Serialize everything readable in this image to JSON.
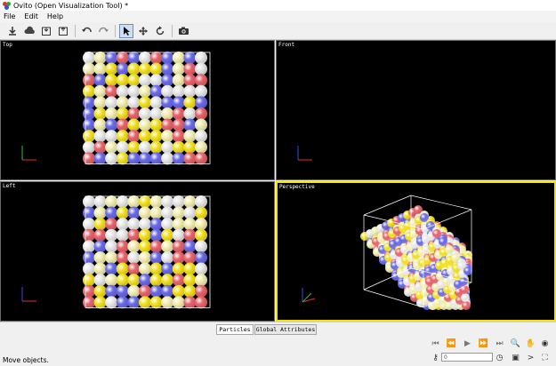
{
  "window": {
    "title": "Ovito (Open Visualization Tool) *"
  },
  "menu": [
    "File",
    "Edit",
    "Help"
  ],
  "toolbar": {
    "icons": [
      "download-icon",
      "cloud-icon",
      "load-file-icon",
      "save-file-icon",
      "undo-icon",
      "redo-icon",
      "select-mode-icon",
      "move-mode-icon",
      "rotate-mode-icon",
      "camera-icon"
    ],
    "active": "select-mode-icon"
  },
  "viewports": [
    {
      "name": "top",
      "caption": "Top",
      "selected": false
    },
    {
      "name": "front",
      "caption": "Front",
      "selected": false
    },
    {
      "name": "left",
      "caption": "Left",
      "selected": false
    },
    {
      "name": "perspective",
      "caption": "Perspective",
      "selected": true
    }
  ],
  "colors": {
    "red": "#e8646c",
    "blue": "#6a6ae8",
    "yellow": "#f2e020",
    "white": "#e8e8e8",
    "cream": "#f2eeb0",
    "highlight": "#f3e500"
  },
  "tabs": {
    "particles": "Particles",
    "global_attributes": "Global Attributes",
    "active": "particles"
  },
  "status": {
    "message": "Move objects."
  },
  "animation": {
    "current_frame": "0"
  }
}
